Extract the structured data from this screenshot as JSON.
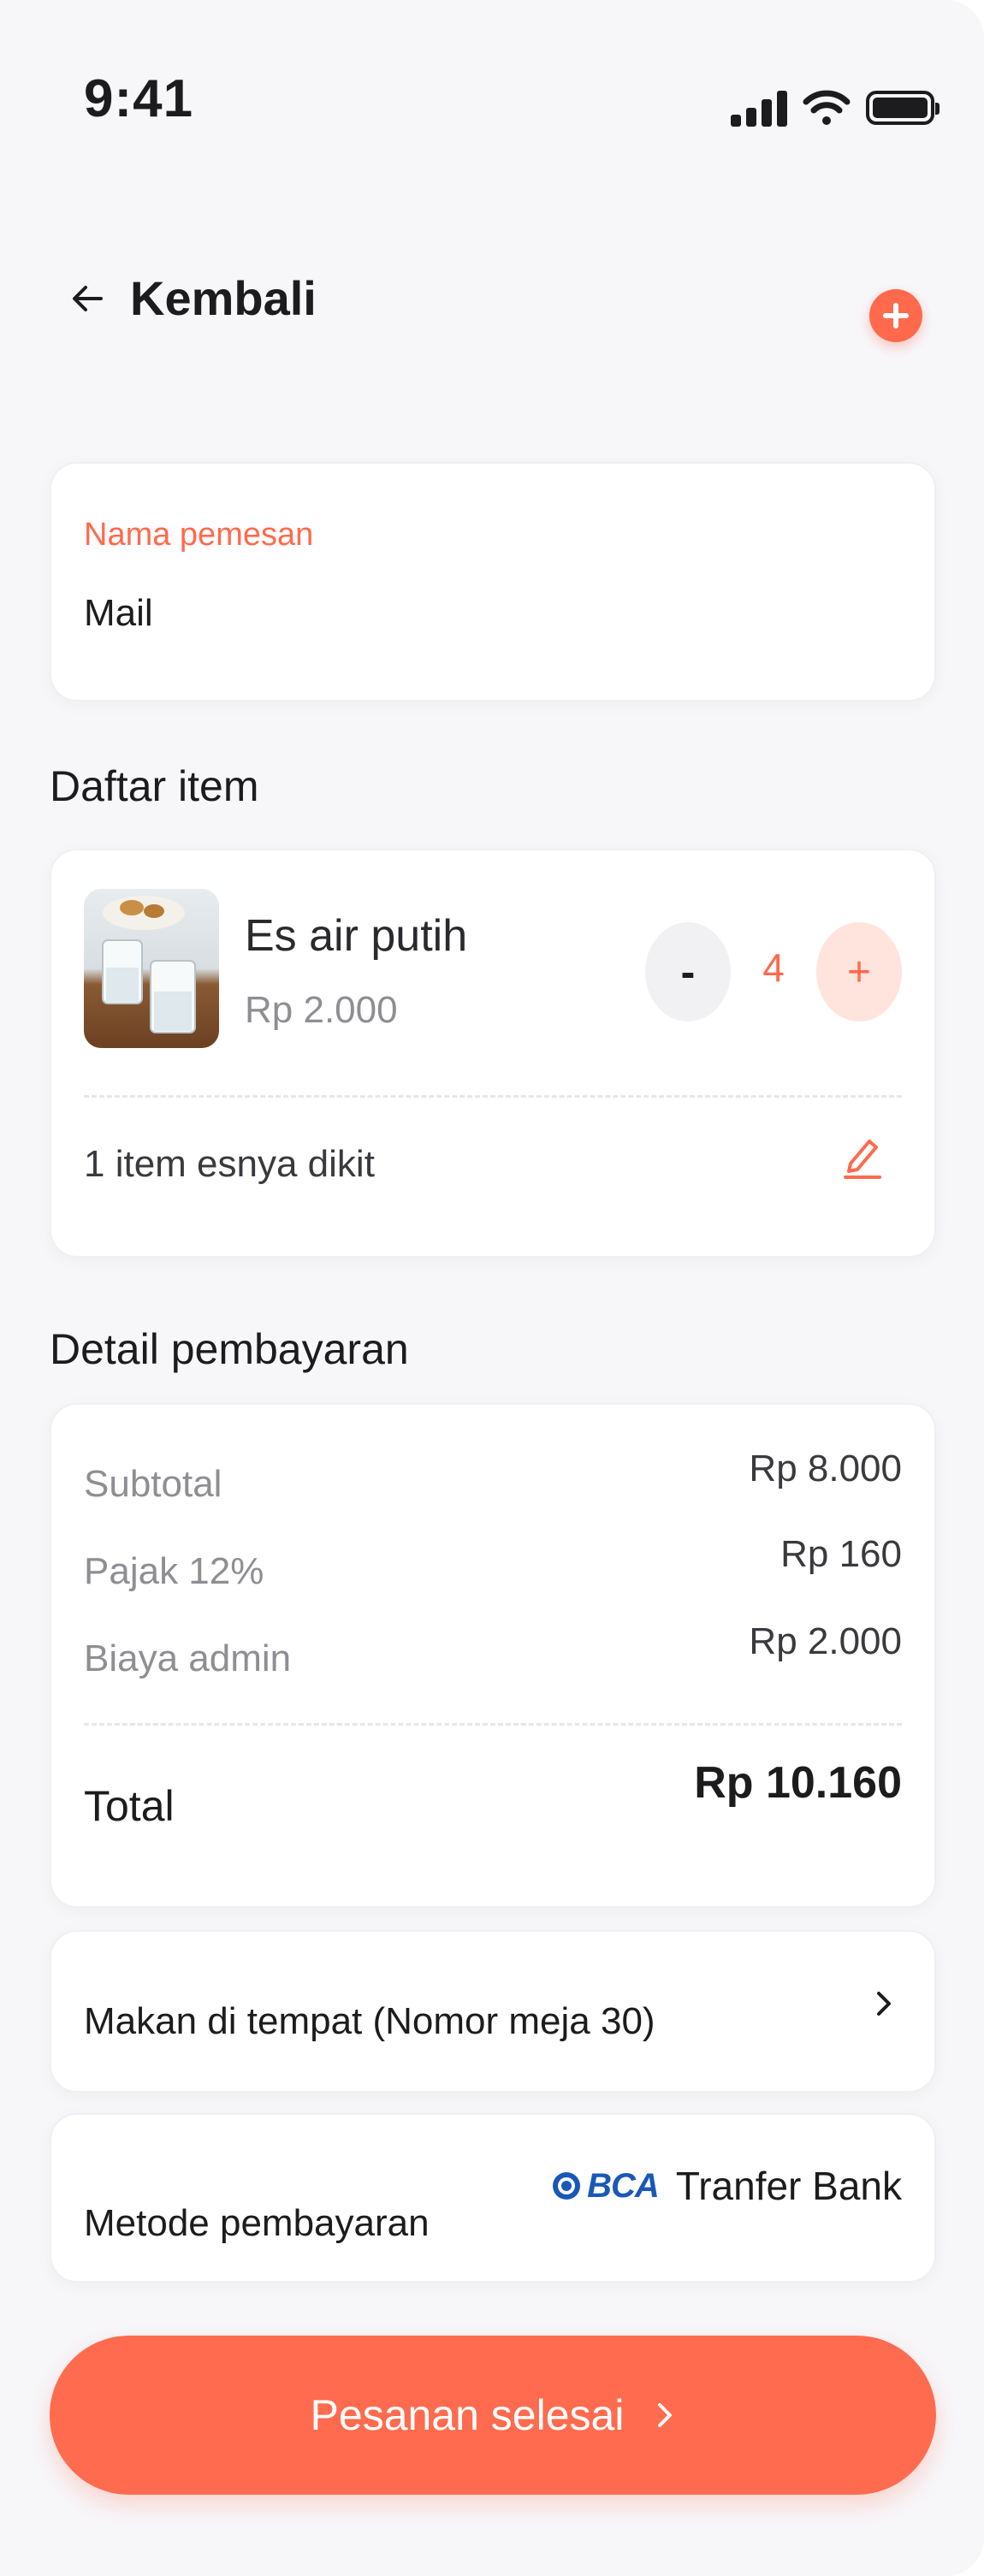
{
  "status_bar": {
    "time": "9:41"
  },
  "header": {
    "back_label": "Kembali"
  },
  "customer": {
    "label": "Nama pemesan",
    "value": "Mail"
  },
  "items_section": {
    "title": "Daftar item",
    "items": [
      {
        "name": "Es air putih",
        "price": "Rp 2.000",
        "quantity": "4",
        "minus_label": "-",
        "plus_label": "+",
        "note": "1 item esnya dikit"
      }
    ]
  },
  "payment_section": {
    "title": "Detail pembayaran",
    "rows": [
      {
        "label": "Subtotal",
        "value": "Rp 8.000"
      },
      {
        "label": "Pajak 12%",
        "value": "Rp 160"
      },
      {
        "label": "Biaya admin",
        "value": "Rp 2.000"
      }
    ],
    "total_label": "Total",
    "total_value": "Rp 10.160"
  },
  "dine_option": {
    "label": "Makan di tempat (Nomor meja 30)"
  },
  "payment_method": {
    "label": "Metode pembayaran",
    "bank_logo": "BCA",
    "value": "Tranfer Bank"
  },
  "cta": {
    "label": "Pesanan selesai"
  },
  "colors": {
    "accent": "#ff6a4d",
    "background": "#f7f7fa",
    "card": "#ffffff",
    "bca_blue": "#1a58b8"
  },
  "icons": [
    "signal-icon",
    "wifi-icon",
    "battery-icon",
    "back-arrow-icon",
    "plus-circle-icon",
    "edit-icon",
    "chevron-right-icon",
    "bca-logo-icon"
  ]
}
